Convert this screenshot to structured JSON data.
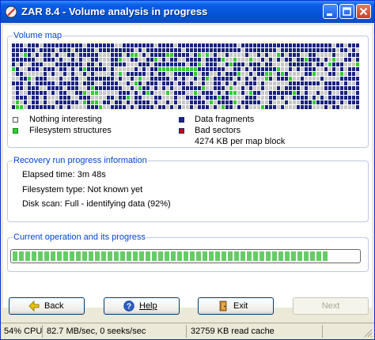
{
  "window": {
    "title": "ZAR 8.4 - Volume analysis in progress"
  },
  "volume_map": {
    "title": "Volume map",
    "legend": {
      "nothing": "Nothing interesting",
      "filesystem": "Filesystem structures",
      "fragments": "Data fragments",
      "bad": "Bad sectors",
      "block_size": "4274 KB per map block"
    },
    "colors": {
      "empty": "#c8c8c8",
      "data": "#1a237e",
      "filesystem": "#33cc33",
      "bad": "#cc0000"
    }
  },
  "recovery": {
    "title": "Recovery run progress information",
    "elapsed": "Elapsed time: 3m 48s",
    "filesystem": "Filesystem type: Not known yet",
    "disk_scan": "Disk scan: Full - identifying data (92%)"
  },
  "operation": {
    "title": "Current operation and its progress",
    "progress_fraction": 0.92,
    "progress_color": "#66cc66"
  },
  "buttons": {
    "back": "Back",
    "help": "Help",
    "exit": "Exit",
    "next": "Next"
  },
  "status": {
    "cpu": "54% CPU",
    "io": "82.7 MB/sec, 0 seeks/sec",
    "cache": "32759 KB read cache"
  }
}
